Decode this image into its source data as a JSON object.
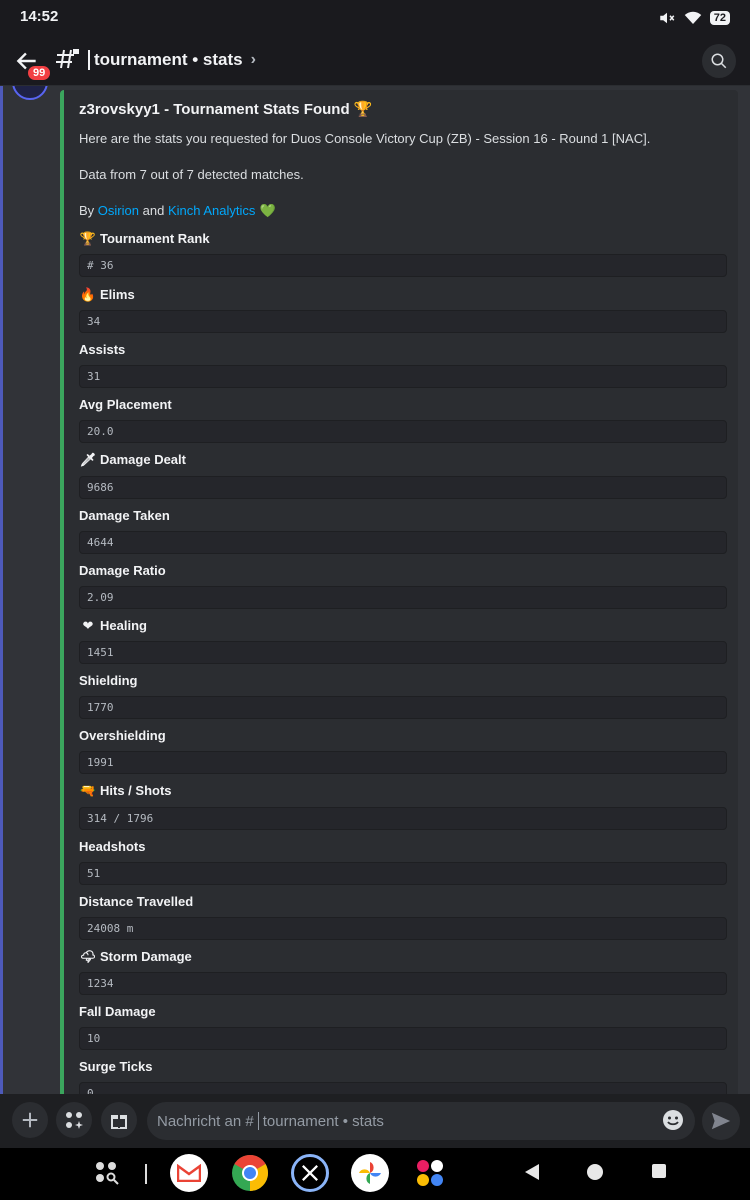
{
  "status": {
    "time": "14:52",
    "battery": "72"
  },
  "header": {
    "badge": "99",
    "channel_name": "tournament • stats",
    "chevron": "›"
  },
  "embed": {
    "title": "z3rovskyy1 - Tournament Stats Found",
    "description_line1": "Here are the stats you requested for Duos Console Victory Cup (ZB) - Session 16 - Round 1 [NAC].",
    "description_line2": "Data from 7 out of 7 detected matches.",
    "credits_prefix": "By",
    "credits_link1": "Osirion",
    "credits_and": "and",
    "credits_link2": "Kinch Analytics",
    "fields": [
      {
        "name": "Tournament Rank",
        "icon": "trophy-icon",
        "value": "# 36"
      },
      {
        "name": "Elims",
        "icon": "fire-icon",
        "value": "34"
      },
      {
        "name": "Assists",
        "icon": "",
        "value": "31"
      },
      {
        "name": "Avg Placement",
        "icon": "",
        "value": "20.0"
      },
      {
        "name": "Damage Dealt",
        "icon": "dagger-icon",
        "value": "9686"
      },
      {
        "name": "Damage Taken",
        "icon": "",
        "value": "4644"
      },
      {
        "name": "Damage Ratio",
        "icon": "",
        "value": "2.09"
      },
      {
        "name": "Healing",
        "icon": "bandaged-heart-icon",
        "value": "1451"
      },
      {
        "name": "Shielding",
        "icon": "",
        "value": "1770"
      },
      {
        "name": "Overshielding",
        "icon": "",
        "value": "1991"
      },
      {
        "name": "Hits / Shots",
        "icon": "water-pistol-icon",
        "value": "314 / 1796"
      },
      {
        "name": "Headshots",
        "icon": "",
        "value": "51"
      },
      {
        "name": "Distance Travelled",
        "icon": "",
        "value": "24008 m"
      },
      {
        "name": "Storm Damage",
        "icon": "storm-cloud-icon",
        "value": "1234"
      },
      {
        "name": "Fall Damage",
        "icon": "",
        "value": "10"
      },
      {
        "name": "Surge Ticks",
        "icon": "",
        "value": "0"
      }
    ]
  },
  "composer": {
    "placeholder_prefix": "Nachricht an #",
    "placeholder_channel": "tournament • stats"
  },
  "colors": {
    "embed_accent": "#3ba55d",
    "link": "#00a8fc",
    "badge": "#f23f43"
  }
}
